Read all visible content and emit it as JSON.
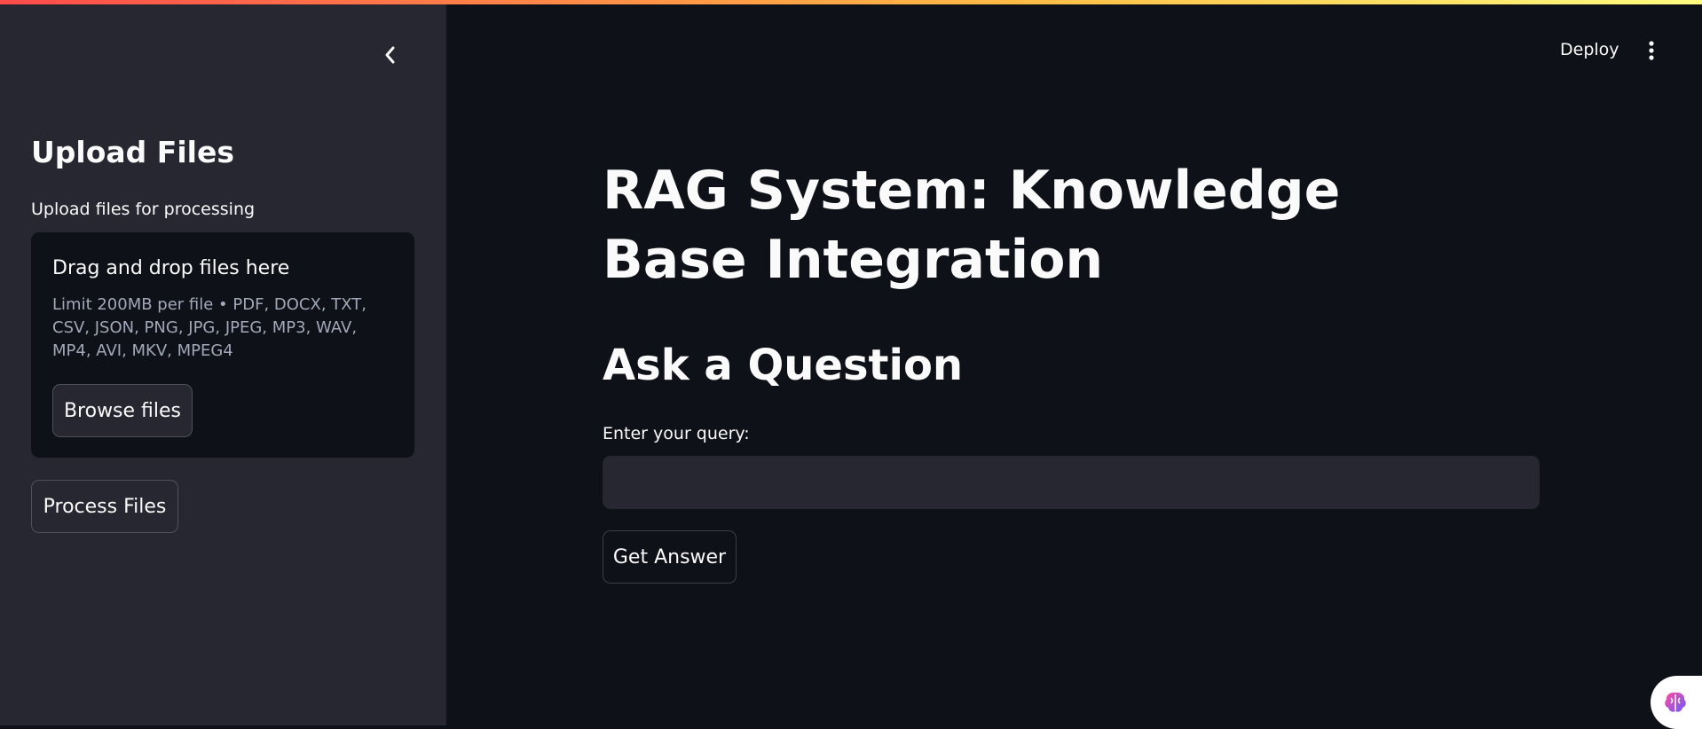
{
  "sidebar": {
    "title": "Upload Files",
    "uploader": {
      "label": "Upload files for processing",
      "drop_text": "Drag and drop files here",
      "limit_text": "Limit 200MB per file • PDF, DOCX, TXT, CSV, JSON, PNG, JPG, JPEG, MP3, WAV, MP4, AVI, MKV, MPEG4",
      "browse_label": "Browse files"
    },
    "process_label": "Process Files"
  },
  "header": {
    "deploy_label": "Deploy"
  },
  "main": {
    "title": "RAG System: Knowledge Base Integration",
    "section_title": "Ask a Question",
    "query_label": "Enter your query:",
    "query_value": "",
    "query_placeholder": "",
    "submit_label": "Get Answer"
  },
  "icons": {
    "collapse": "chevron-left-icon",
    "menu": "more-vertical-icon",
    "badge": "brain-icon"
  },
  "colors": {
    "background": "#0e1117",
    "sidebar": "#262730",
    "text": "#fafafa",
    "muted": "#a3a8b8",
    "accent": "#ff4b4b"
  }
}
